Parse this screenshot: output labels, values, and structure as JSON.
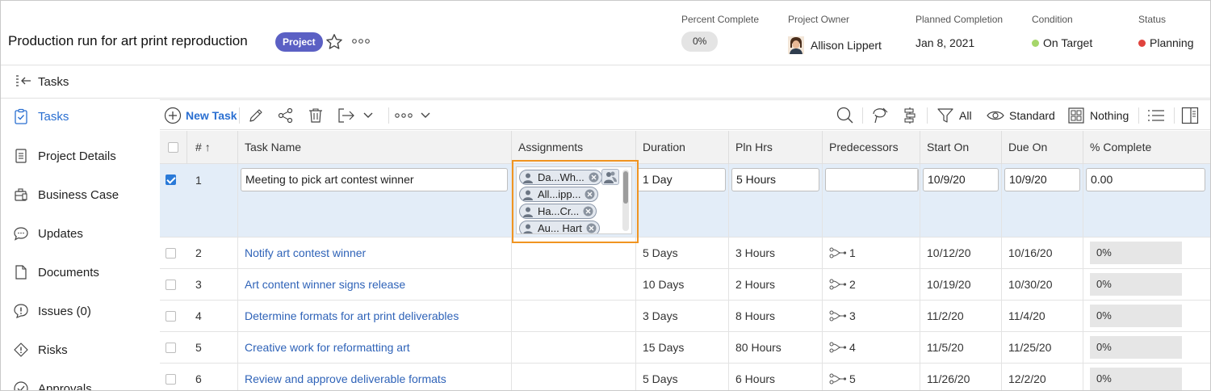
{
  "header": {
    "title": "Production run for art print reproduction",
    "badge": "Project",
    "star_icon": "star-outline-icon",
    "more_icon": "ellipsis-icon",
    "fields": {
      "percent_complete": {
        "label": "Percent Complete",
        "value": "0%"
      },
      "project_owner": {
        "label": "Project Owner",
        "value": "Allison Lippert"
      },
      "planned_completion": {
        "label": "Planned Completion",
        "value": "Jan 8, 2021"
      },
      "condition": {
        "label": "Condition",
        "value": "On Target",
        "color": "#a6d66a"
      },
      "status": {
        "label": "Status",
        "value": "Planning",
        "color": "#e0433d"
      }
    }
  },
  "section": {
    "title": "Tasks"
  },
  "sidebar": {
    "items": [
      {
        "label": "Tasks",
        "icon": "clipboard-check-icon",
        "active": true
      },
      {
        "label": "Project Details",
        "icon": "document-icon"
      },
      {
        "label": "Business Case",
        "icon": "business-case-icon"
      },
      {
        "label": "Updates",
        "icon": "speech-bubble-icon"
      },
      {
        "label": "Documents",
        "icon": "page-icon"
      },
      {
        "label": "Issues (0)",
        "icon": "issue-icon"
      },
      {
        "label": "Risks",
        "icon": "risk-icon"
      },
      {
        "label": "Approvals",
        "icon": "approval-icon"
      }
    ]
  },
  "toolbar": {
    "new_task": "New Task",
    "filter_label": "All",
    "view_label": "Standard",
    "group_label": "Nothing"
  },
  "grid": {
    "columns": [
      "#",
      "Task Name",
      "Assignments",
      "Duration",
      "Pln Hrs",
      "Predecessors",
      "Start On",
      "Due On",
      "% Complete"
    ],
    "sort_indicator": "↑",
    "editing_row": {
      "num": "1",
      "task_name": "Meeting to pick art contest winner",
      "assignments": [
        "Da...Wh...",
        "All...ipp...",
        "Ha...Cr...",
        "Au... Hart"
      ],
      "duration": "1 Day",
      "pln_hrs": "5 Hours",
      "predecessors": "",
      "start_on": "10/9/20",
      "due_on": "10/9/20",
      "pct_complete": "0.00",
      "checked": true
    },
    "rows": [
      {
        "num": "2",
        "task_name": "Notify art contest winner",
        "duration": "5 Days",
        "pln_hrs": "3 Hours",
        "pred": "1",
        "start_on": "10/12/20",
        "due_on": "10/16/20",
        "pct": "0%"
      },
      {
        "num": "3",
        "task_name": "Art content winner signs release",
        "duration": "10 Days",
        "pln_hrs": "2 Hours",
        "pred": "2",
        "start_on": "10/19/20",
        "due_on": "10/30/20",
        "pct": "0%"
      },
      {
        "num": "4",
        "task_name": "Determine formats for art print deliverables",
        "duration": "3 Days",
        "pln_hrs": "8 Hours",
        "pred": "3",
        "start_on": "11/2/20",
        "due_on": "11/4/20",
        "pct": "0%"
      },
      {
        "num": "5",
        "task_name": "Creative work for reformatting art",
        "duration": "15 Days",
        "pln_hrs": "80 Hours",
        "pred": "4",
        "start_on": "11/5/20",
        "due_on": "11/25/20",
        "pct": "0%"
      },
      {
        "num": "6",
        "task_name": "Review and approve deliverable formats",
        "duration": "5 Days",
        "pln_hrs": "6 Hours",
        "pred": "5",
        "start_on": "11/26/20",
        "due_on": "12/2/20",
        "pct": "0%"
      }
    ]
  }
}
